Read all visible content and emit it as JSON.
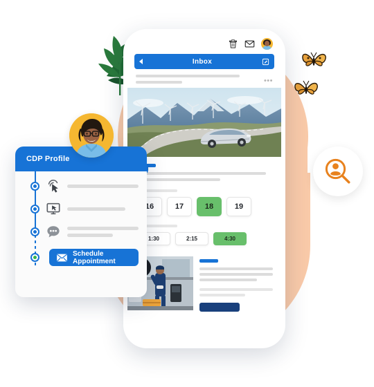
{
  "scene": {
    "title": "Automotive CDP appointment scheduling illustration",
    "colors": {
      "brand_blue": "#1773d6",
      "navy": "#19407c",
      "peach": "#f9caa9",
      "green_selected": "#68bf6b",
      "avatar_yellow": "#f5b731",
      "orange_accent": "#e8821e",
      "leaf_green": "#1f6b33"
    }
  },
  "phone": {
    "topbar": {
      "trash_icon": "trash-icon",
      "mail_icon": "envelope-icon",
      "avatar_icon": "user-avatar"
    },
    "navbar": {
      "back_icon": "chevron-left-icon",
      "title": "Inbox",
      "compose_icon": "compose-pencil-square-icon"
    },
    "mail_row": {
      "overflow_menu": "•••"
    },
    "hero_image": {
      "alt": "Silver sports car driving on a winding mountain road with wind turbines"
    },
    "appointment": {
      "days_label": "",
      "days": [
        {
          "label": "16",
          "selected": false
        },
        {
          "label": "17",
          "selected": false
        },
        {
          "label": "18",
          "selected": true
        },
        {
          "label": "19",
          "selected": false
        }
      ],
      "times_label": "",
      "times": [
        {
          "label": "1:30",
          "selected": false
        },
        {
          "label": "2:15",
          "selected": false
        },
        {
          "label": "4:30",
          "selected": true
        }
      ]
    },
    "service_block": {
      "image_alt": "Mechanic servicing a vehicle on a lift in a garage",
      "cta_label": ""
    }
  },
  "cdp_card": {
    "header_title": "CDP Profile",
    "timeline": [
      {
        "icon": "click-cursor-icon",
        "label": ""
      },
      {
        "icon": "desktop-monitor-icon",
        "label": ""
      },
      {
        "icon": "chat-bubble-icon",
        "label": ""
      }
    ],
    "cta": {
      "icon": "envelope-icon",
      "label": "Schedule Appointment"
    }
  },
  "decorations": {
    "persona_avatar": "woman-with-glasses-avatar",
    "search_badge_icon": "user-search-icon",
    "butterflies": [
      "butterfly-icon",
      "butterfly-icon"
    ],
    "plant": "plant-leaves-icon"
  }
}
